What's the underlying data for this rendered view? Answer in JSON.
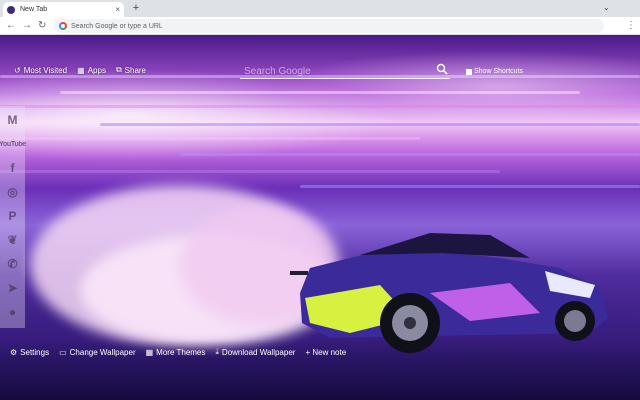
{
  "browser": {
    "tab_title": "New Tab",
    "new_tab_symbol": "+",
    "close_symbol": "×",
    "omnibox_placeholder": "Search Google or type a URL"
  },
  "topnav": [
    {
      "label": "Most Visited",
      "icon": "history-icon"
    },
    {
      "label": "Apps",
      "icon": "apps-grid-icon"
    },
    {
      "label": "Share",
      "icon": "share-icon"
    }
  ],
  "search": {
    "placeholder": "Search Google"
  },
  "shortcuts_label": "Show Shortcuts",
  "sidebar": [
    {
      "name": "gmail-icon",
      "glyph": "M"
    },
    {
      "name": "youtube-icon",
      "glyph": "YouTube"
    },
    {
      "name": "facebook-icon",
      "glyph": "f"
    },
    {
      "name": "instagram-icon",
      "glyph": "◎"
    },
    {
      "name": "pinterest-icon",
      "glyph": "P"
    },
    {
      "name": "twitter-icon",
      "glyph": "🐦"
    },
    {
      "name": "whatsapp-icon",
      "glyph": "✆"
    },
    {
      "name": "telegram-icon",
      "glyph": "➤"
    },
    {
      "name": "reddit-icon",
      "glyph": "●"
    }
  ],
  "bottombar": [
    {
      "label": "Settings",
      "icon": "gear-icon"
    },
    {
      "label": "Change Wallpaper",
      "icon": "image-icon"
    },
    {
      "label": "More Themes",
      "icon": "grid-icon"
    },
    {
      "label": "Download Wallpaper",
      "icon": "download-icon"
    },
    {
      "label": "+ New note",
      "icon": ""
    }
  ],
  "colors": {
    "tabstrip": "#dee1e6",
    "wallpaper_accent": "#b05bd8",
    "car_body": "#3a2a9a",
    "car_livery": "#d8f040"
  }
}
